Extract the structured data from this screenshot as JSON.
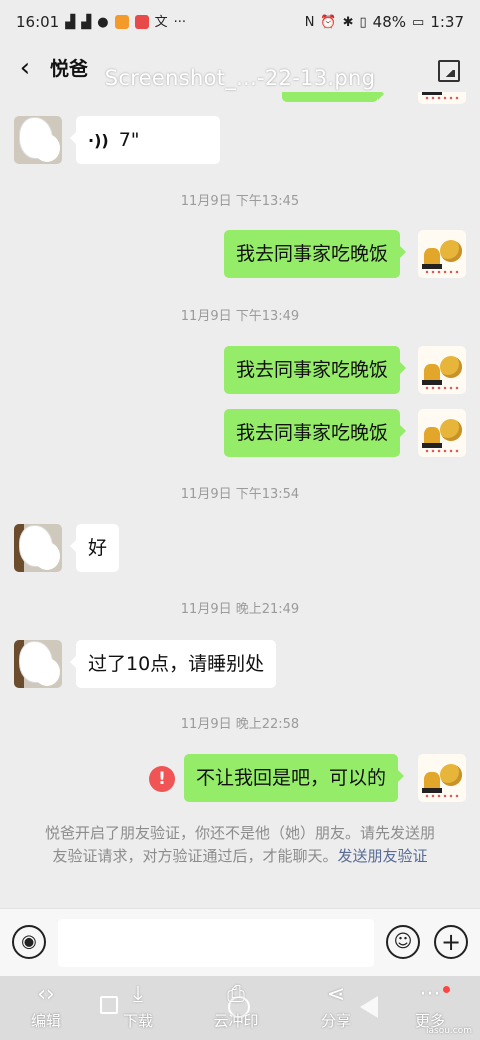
{
  "status": {
    "time": "16:01",
    "battery": "48%",
    "clock": "1:37",
    "left_icons": [
      "4g-signal-icon",
      "4g-signal-icon",
      "app-icon",
      "chat-icon",
      "video-icon",
      "shop-icon",
      "translate-icon",
      "more-dots-icon"
    ],
    "right_icons": [
      "nfc-icon",
      "alarm-icon",
      "bluetooth-icon",
      "vibrate-icon",
      "battery-icon"
    ]
  },
  "header": {
    "back_glyph": "‹",
    "title": "悦爸",
    "file_name": "Screenshot_...-22-13.png",
    "image_icon": "image-icon"
  },
  "messages": [
    {
      "type": "voice",
      "side": "left",
      "text": "7\""
    },
    {
      "type": "time",
      "text": "11月9日 下午13:45"
    },
    {
      "type": "text",
      "side": "right",
      "text": "我去同事家吃晚饭"
    },
    {
      "type": "time",
      "text": "11月9日 下午13:49"
    },
    {
      "type": "text",
      "side": "right",
      "text": "我去同事家吃晚饭"
    },
    {
      "type": "text",
      "side": "right",
      "text": "我去同事家吃晚饭"
    },
    {
      "type": "time",
      "text": "11月9日 下午13:54"
    },
    {
      "type": "text",
      "side": "left",
      "text": "好"
    },
    {
      "type": "time",
      "text": "11月9日 晚上21:49"
    },
    {
      "type": "text",
      "side": "left",
      "text": "过了10点，请睡别处"
    },
    {
      "type": "time",
      "text": "11月9日 晚上22:58"
    },
    {
      "type": "text",
      "side": "right",
      "text": "不让我回是吧，可以的",
      "failed": true,
      "error_glyph": "!"
    }
  ],
  "notice": {
    "text": "悦爸开启了朋友验证，你还不是他（她）朋友。请先发送朋友验证请求，对方验证通过后，才能聊天。",
    "link": "发送朋友验证"
  },
  "input_bar": {
    "voice_glyph": "◉",
    "emoji_glyph": "☺",
    "plus_glyph": "+"
  },
  "toolbar": {
    "items": [
      {
        "label": "编辑",
        "glyph": "‹›"
      },
      {
        "label": "下载",
        "glyph": "⤓"
      },
      {
        "label": "云冲印",
        "glyph": "⎙"
      },
      {
        "label": "分享",
        "glyph": "⋖"
      },
      {
        "label": "更多",
        "glyph": "···"
      }
    ],
    "watermark": "iasou.com"
  },
  "colors": {
    "sent_bubble": "#95ec69",
    "received_bubble": "#ffffff",
    "link": "#576b95",
    "error": "#f05454"
  }
}
